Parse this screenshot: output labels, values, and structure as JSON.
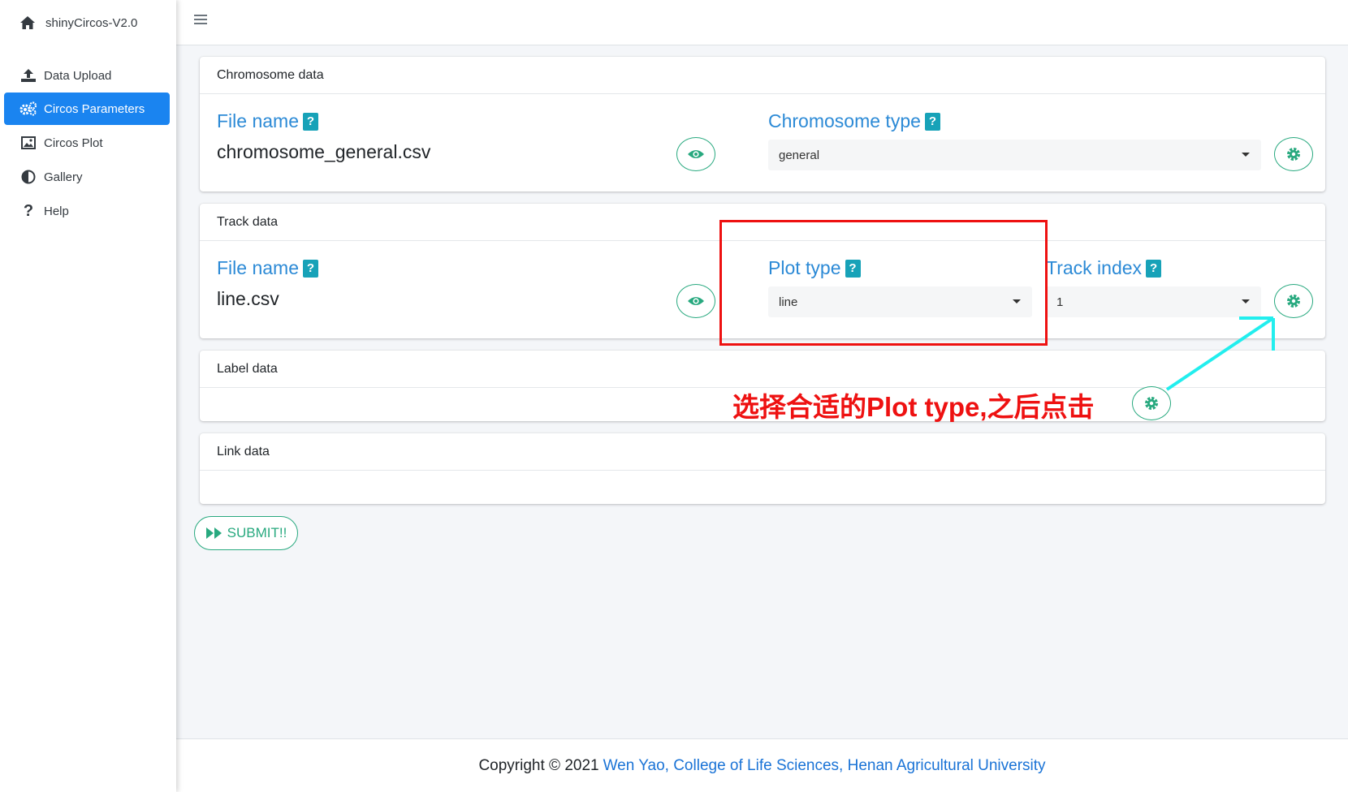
{
  "app": {
    "brand": "shinyCircos-V2.0"
  },
  "sidebar": {
    "items": [
      {
        "label": "Data Upload",
        "icon": "upload-icon"
      },
      {
        "label": "Circos Parameters",
        "icon": "cogs-icon",
        "active": true
      },
      {
        "label": "Circos Plot",
        "icon": "image-icon"
      },
      {
        "label": "Gallery",
        "icon": "adjust-icon"
      },
      {
        "label": "Help",
        "icon": "question-icon"
      }
    ]
  },
  "cards": {
    "chromosome": {
      "title": "Chromosome data",
      "file_label": "File name",
      "file_value": "chromosome_general.csv",
      "type_label": "Chromosome type",
      "type_value": "general"
    },
    "track": {
      "title": "Track data",
      "file_label": "File name",
      "file_value": "line.csv",
      "plot_type_label": "Plot type",
      "plot_type_value": "line",
      "track_index_label": "Track index",
      "track_index_value": "1"
    },
    "label": {
      "title": "Label data"
    },
    "link": {
      "title": "Link data"
    }
  },
  "buttons": {
    "submit_label": "SUBMIT!!",
    "help_badge": "?"
  },
  "footer": {
    "prefix": "Copyright © 2021",
    "link_text": "Wen Yao, College of Life Sciences, Henan Agricultural University"
  },
  "annotation": {
    "text": "选择合适的Plot type,之后点击",
    "box_color": "#ee1111",
    "arrow_color": "#22eeee"
  },
  "colors": {
    "accent": "#1a84f0",
    "label_blue": "#2c8ad6",
    "badge_teal": "#17a2b8",
    "button_green": "#28a97f"
  }
}
